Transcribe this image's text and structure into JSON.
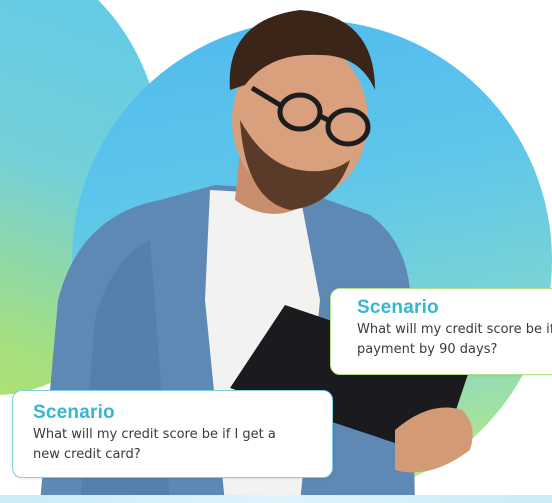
{
  "cards": {
    "right": {
      "title": "Scenario",
      "line1": "What will my credit score be if I miss a",
      "line2": "payment by 90 days?"
    },
    "left": {
      "title": "Scenario",
      "line1": "What will my credit score be if I get a",
      "line2": "new credit card?"
    }
  },
  "colors": {
    "title_teal": "#35b6d4",
    "circle_blue": "#4fb9ef",
    "circle_green": "#a7e39a",
    "card_border_left": "#7fd0e0",
    "card_border_right": "#b4e08a"
  }
}
